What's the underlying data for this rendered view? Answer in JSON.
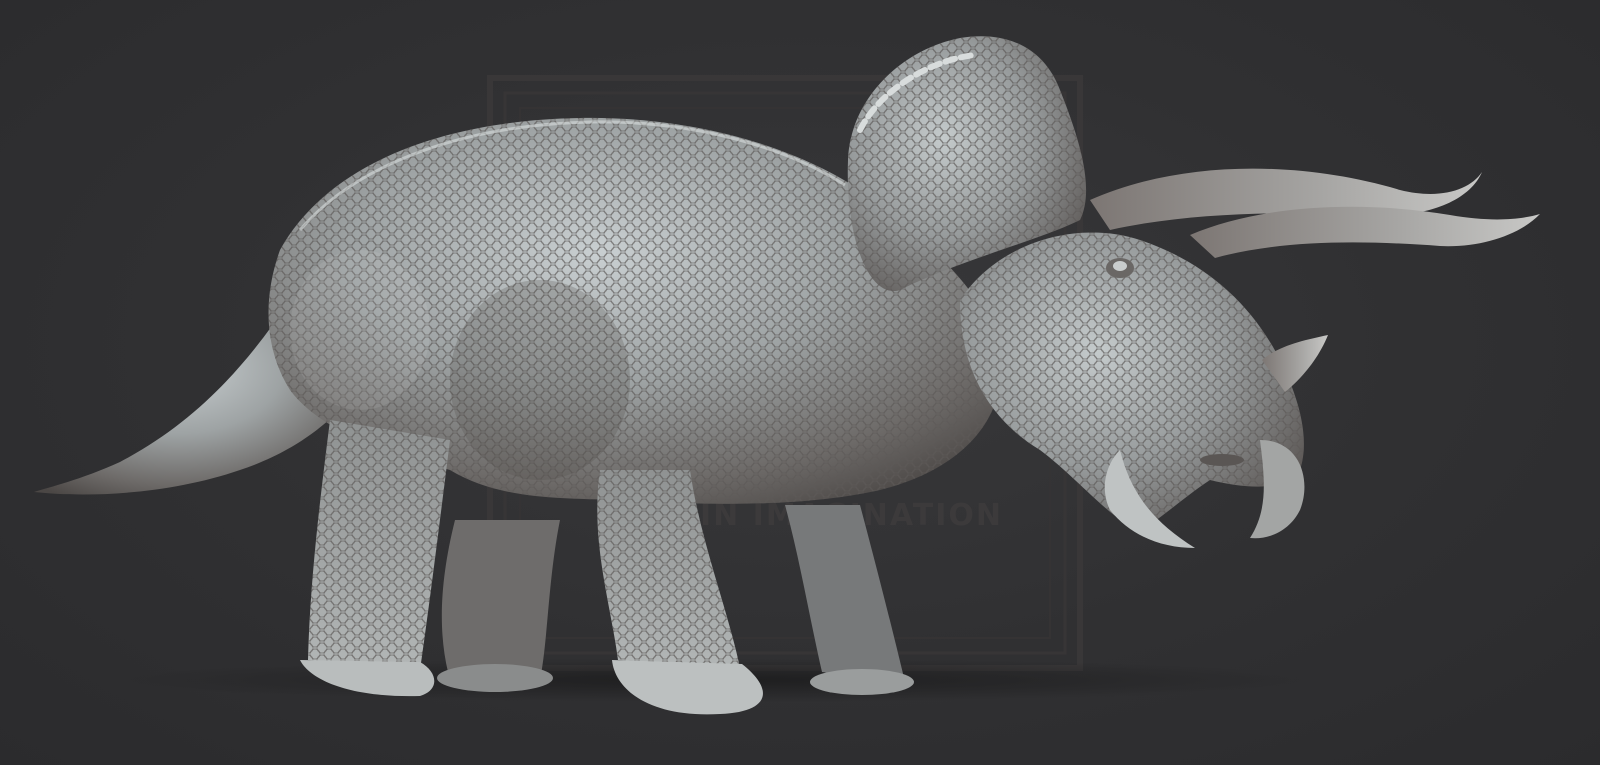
{
  "scene": {
    "background_color": "#2f2f31",
    "subject": "triceratops-sculpt",
    "material_color": "#9a9ea0",
    "highlight_color": "#d8dcdc"
  },
  "watermark": {
    "text": "IN IMAGINATION",
    "color": "#3d3b3c"
  }
}
